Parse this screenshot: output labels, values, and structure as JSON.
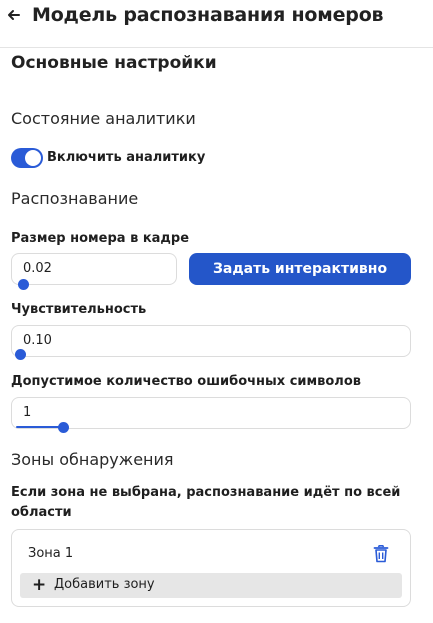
{
  "header": {
    "title": "Модель распознавания номеров",
    "back_icon": "arrow-left-icon"
  },
  "main": {
    "section_title": "Основные настройки",
    "analytics_state_heading": "Состояние аналитики",
    "analytics_toggle": {
      "label": "Включить аналитику",
      "enabled": true
    },
    "recognition_heading": "Распознавание",
    "plate_size": {
      "label": "Размер номера в кадре",
      "value": "0.02",
      "slider_level": 0.02,
      "button_label": "Задать интерактивно"
    },
    "sensitivity": {
      "label": "Чувствительность",
      "value": "0.10",
      "slider_level": 0.0
    },
    "error_chars": {
      "label": "Допустимое количество ошибочных символов",
      "value": "1",
      "slider_level": 0.13
    },
    "zones": {
      "heading": "Зоны обнаружения",
      "hint": "Если зона не выбрана, распознавание идёт по всей области",
      "items": [
        {
          "label": "Зона 1",
          "delete_icon": "trash-icon"
        }
      ],
      "add_label": "Добавить зону",
      "add_icon": "plus-icon"
    }
  },
  "colors": {
    "accent": "#2a5bd7",
    "button_bg": "#2456c9",
    "trash_icon": "#2a5bd7",
    "add_zone_bg": "#e6e6e6"
  }
}
